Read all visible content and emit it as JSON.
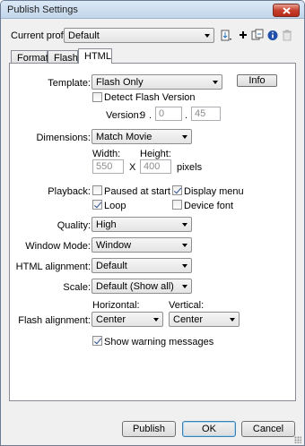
{
  "window": {
    "title": "Publish Settings"
  },
  "profile": {
    "label": "Current profile:",
    "value": "Default"
  },
  "tabs": [
    {
      "label": "Formats"
    },
    {
      "label": "Flash"
    },
    {
      "label": "HTML"
    }
  ],
  "template": {
    "label": "Template:",
    "value": "Flash Only",
    "info_button": "Info",
    "detect_label": "Detect Flash Version",
    "version_label": "Version:",
    "version_major": "9",
    "version_minor": "0",
    "version_rev": "45",
    "dot": "."
  },
  "dimensions": {
    "label": "Dimensions:",
    "value": "Match Movie",
    "width_label": "Width:",
    "height_label": "Height:",
    "width": "550",
    "height": "400",
    "x_sep": "X",
    "units": "pixels"
  },
  "playback": {
    "label": "Playback:",
    "paused": "Paused at start",
    "display_menu": "Display menu",
    "loop": "Loop",
    "device_font": "Device font",
    "paused_checked": false,
    "display_menu_checked": true,
    "loop_checked": true,
    "device_font_checked": false
  },
  "quality": {
    "label": "Quality:",
    "value": "High"
  },
  "window_mode": {
    "label": "Window Mode:",
    "value": "Window"
  },
  "html_alignment": {
    "label": "HTML alignment:",
    "value": "Default"
  },
  "scale": {
    "label": "Scale:",
    "value": "Default (Show all)"
  },
  "flash_alignment": {
    "label": "Flash alignment:",
    "horizontal_label": "Horizontal:",
    "vertical_label": "Vertical:",
    "horizontal": "Center",
    "vertical": "Center"
  },
  "warnings": {
    "label": "Show warning messages",
    "checked": true
  },
  "footer": {
    "publish": "Publish",
    "ok": "OK",
    "cancel": "Cancel"
  }
}
